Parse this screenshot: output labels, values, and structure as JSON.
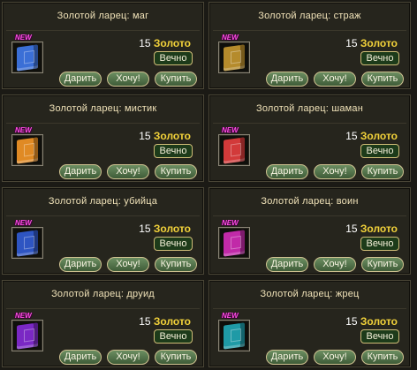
{
  "items": [
    {
      "title": "Золотой ларец: маг",
      "book_color": "#3b6fd6",
      "badge": "NEW",
      "price": "15",
      "currency": "Золото",
      "duration": "Вечно",
      "buttons": {
        "gift": "Дарить",
        "want": "Хочу!",
        "buy": "Купить"
      }
    },
    {
      "title": "Золотой ларец: страж",
      "book_color": "#b58b2c",
      "badge": "NEW",
      "price": "15",
      "currency": "Золото",
      "duration": "Вечно",
      "buttons": {
        "gift": "Дарить",
        "want": "Хочу!",
        "buy": "Купить"
      }
    },
    {
      "title": "Золотой ларец: мистик",
      "book_color": "#e08a24",
      "badge": "NEW",
      "price": "15",
      "currency": "Золото",
      "duration": "Вечно",
      "buttons": {
        "gift": "Дарить",
        "want": "Хочу!",
        "buy": "Купить"
      }
    },
    {
      "title": "Золотой ларец: шаман",
      "book_color": "#d23a3a",
      "badge": "NEW",
      "price": "15",
      "currency": "Золото",
      "duration": "Вечно",
      "buttons": {
        "gift": "Дарить",
        "want": "Хочу!",
        "buy": "Купить"
      }
    },
    {
      "title": "Золотой ларец: убийца",
      "book_color": "#2e55c2",
      "badge": "NEW",
      "price": "15",
      "currency": "Золото",
      "duration": "Вечно",
      "buttons": {
        "gift": "Дарить",
        "want": "Хочу!",
        "buy": "Купить"
      }
    },
    {
      "title": "Золотой ларец: воин",
      "book_color": "#c12aa8",
      "badge": "NEW",
      "price": "15",
      "currency": "Золото",
      "duration": "Вечно",
      "buttons": {
        "gift": "Дарить",
        "want": "Хочу!",
        "buy": "Купить"
      }
    },
    {
      "title": "Золотой ларец: друид",
      "book_color": "#7a28c4",
      "badge": "NEW",
      "price": "15",
      "currency": "Золото",
      "duration": "Вечно",
      "buttons": {
        "gift": "Дарить",
        "want": "Хочу!",
        "buy": "Купить"
      }
    },
    {
      "title": "Золотой ларец: жрец",
      "book_color": "#1f9aa6",
      "badge": "NEW",
      "price": "15",
      "currency": "Золото",
      "duration": "Вечно",
      "buttons": {
        "gift": "Дарить",
        "want": "Хочу!",
        "buy": "Купить"
      }
    }
  ]
}
